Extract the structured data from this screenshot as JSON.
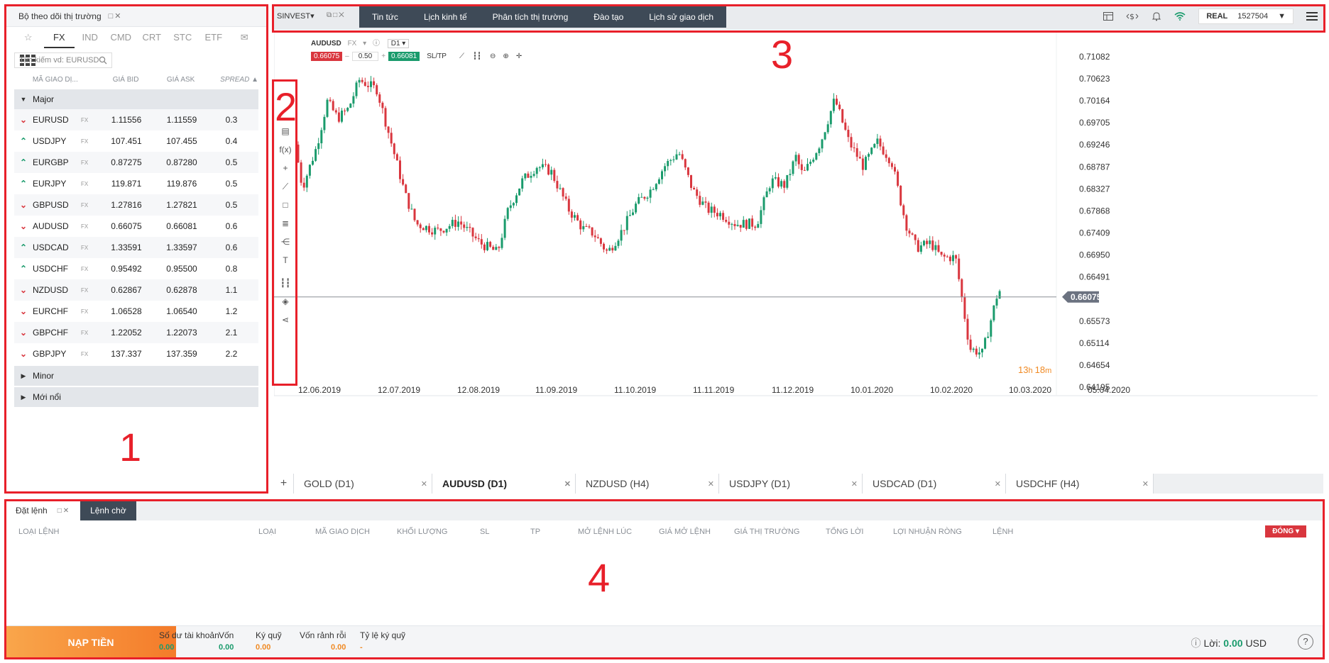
{
  "watchlist": {
    "title": "Bộ theo dõi thị trường",
    "tabs": [
      "☆",
      "FX",
      "IND",
      "CMD",
      "CRT",
      "STC",
      "ETF"
    ],
    "search_placeholder": "Tìm kiếm vd: EURUSD",
    "columns": [
      "MÃ GIAO DỊ...",
      "GIÁ BID",
      "GIÁ ASK",
      "SPREAD ▲"
    ],
    "groups": [
      "Major",
      "Minor",
      "Mới nổi"
    ],
    "class_tag": "FX",
    "rows": [
      {
        "dir": "down",
        "sym": "EURUSD",
        "bid": "1.11556",
        "ask": "1.11559",
        "spread": "0.3"
      },
      {
        "dir": "up",
        "sym": "USDJPY",
        "bid": "107.451",
        "ask": "107.455",
        "spread": "0.4"
      },
      {
        "dir": "up",
        "sym": "EURGBP",
        "bid": "0.87275",
        "ask": "0.87280",
        "spread": "0.5"
      },
      {
        "dir": "up",
        "sym": "EURJPY",
        "bid": "119.871",
        "ask": "119.876",
        "spread": "0.5"
      },
      {
        "dir": "down",
        "sym": "GBPUSD",
        "bid": "1.27816",
        "ask": "1.27821",
        "spread": "0.5"
      },
      {
        "dir": "down",
        "sym": "AUDUSD",
        "bid": "0.66075",
        "ask": "0.66081",
        "spread": "0.6"
      },
      {
        "dir": "up",
        "sym": "USDCAD",
        "bid": "1.33591",
        "ask": "1.33597",
        "spread": "0.6"
      },
      {
        "dir": "up",
        "sym": "USDCHF",
        "bid": "0.95492",
        "ask": "0.95500",
        "spread": "0.8"
      },
      {
        "dir": "down",
        "sym": "NZDUSD",
        "bid": "0.62867",
        "ask": "0.62878",
        "spread": "1.1"
      },
      {
        "dir": "down",
        "sym": "EURCHF",
        "bid": "1.06528",
        "ask": "1.06540",
        "spread": "1.2"
      },
      {
        "dir": "down",
        "sym": "GBPCHF",
        "bid": "1.22052",
        "ask": "1.22073",
        "spread": "2.1"
      },
      {
        "dir": "down",
        "sym": "GBPJPY",
        "bid": "137.337",
        "ask": "137.359",
        "spread": "2.2"
      }
    ]
  },
  "topbar": {
    "brand": "SINVEST▾",
    "menu": [
      "Tin tức",
      "Lịch kinh tế",
      "Phân tích thị trường",
      "Đào tạo",
      "Lịch sử giao dịch"
    ],
    "account_type": "REAL",
    "account_id": "1527504"
  },
  "chart": {
    "symbol": "AUDUSD",
    "class": "FX",
    "timeframe": "D1",
    "bid_chip": "0.66075",
    "lot": "0.50",
    "ask_chip": "0.66081",
    "sltp": "SL/TP",
    "current_price": "0.66075",
    "countdown_h": "13",
    "countdown_m": "18",
    "price_labels": [
      "0.71082",
      "0.70623",
      "0.70164",
      "0.69705",
      "0.69246",
      "0.68787",
      "0.68327",
      "0.67868",
      "0.67409",
      "0.66950",
      "0.66491",
      "0.65573",
      "0.65114",
      "0.64654",
      "0.64195"
    ],
    "date_labels": [
      "12.06.2019",
      "12.07.2019",
      "12.08.2019",
      "11.09.2019",
      "11.10.2019",
      "11.11.2019",
      "11.12.2019",
      "10.01.2020",
      "10.02.2020",
      "10.03.2020",
      "05.04.2020"
    ],
    "accent_up": "#1a9b6c",
    "accent_down": "#d9363e"
  },
  "chart_tabs": [
    {
      "label": "GOLD (D1)",
      "active": false
    },
    {
      "label": "AUDUSD (D1)",
      "active": true
    },
    {
      "label": "NZDUSD (H4)",
      "active": false
    },
    {
      "label": "USDJPY (D1)",
      "active": false
    },
    {
      "label": "USDCAD (D1)",
      "active": false
    },
    {
      "label": "USDCHF (H4)",
      "active": false
    }
  ],
  "orders": {
    "tabs": [
      "Đặt lệnh",
      "Lệnh chờ"
    ],
    "columns": [
      "LOẠI LỆNH",
      "LOẠI",
      "MÃ GIAO DỊCH",
      "KHỐI LƯỢNG",
      "SL",
      "TP",
      "MỞ LỆNH LÚC",
      "GIÁ MỞ LỆNH",
      "GIÁ THỊ TRƯỜNG",
      "TỔNG LỜI",
      "LỢI NHUẬN RÒNG",
      "LỆNH"
    ],
    "close_button": "ĐÓNG ▾",
    "deposit": "NẠP TIỀN",
    "stats": [
      {
        "label": "Số dư tài khoản",
        "value": "0.00"
      },
      {
        "label": "Vốn",
        "value": "0.00"
      },
      {
        "label": "Ký quỹ",
        "value": "0.00"
      },
      {
        "label": "Vốn rảnh rỗi",
        "value": "0.00"
      },
      {
        "label": "Tỷ lệ ký quỹ",
        "value": "-"
      }
    ],
    "profit_label": "Lời:",
    "profit_value": "0.00",
    "profit_currency": "USD",
    "help": "?"
  },
  "annotations": [
    "1",
    "2",
    "3",
    "4"
  ]
}
